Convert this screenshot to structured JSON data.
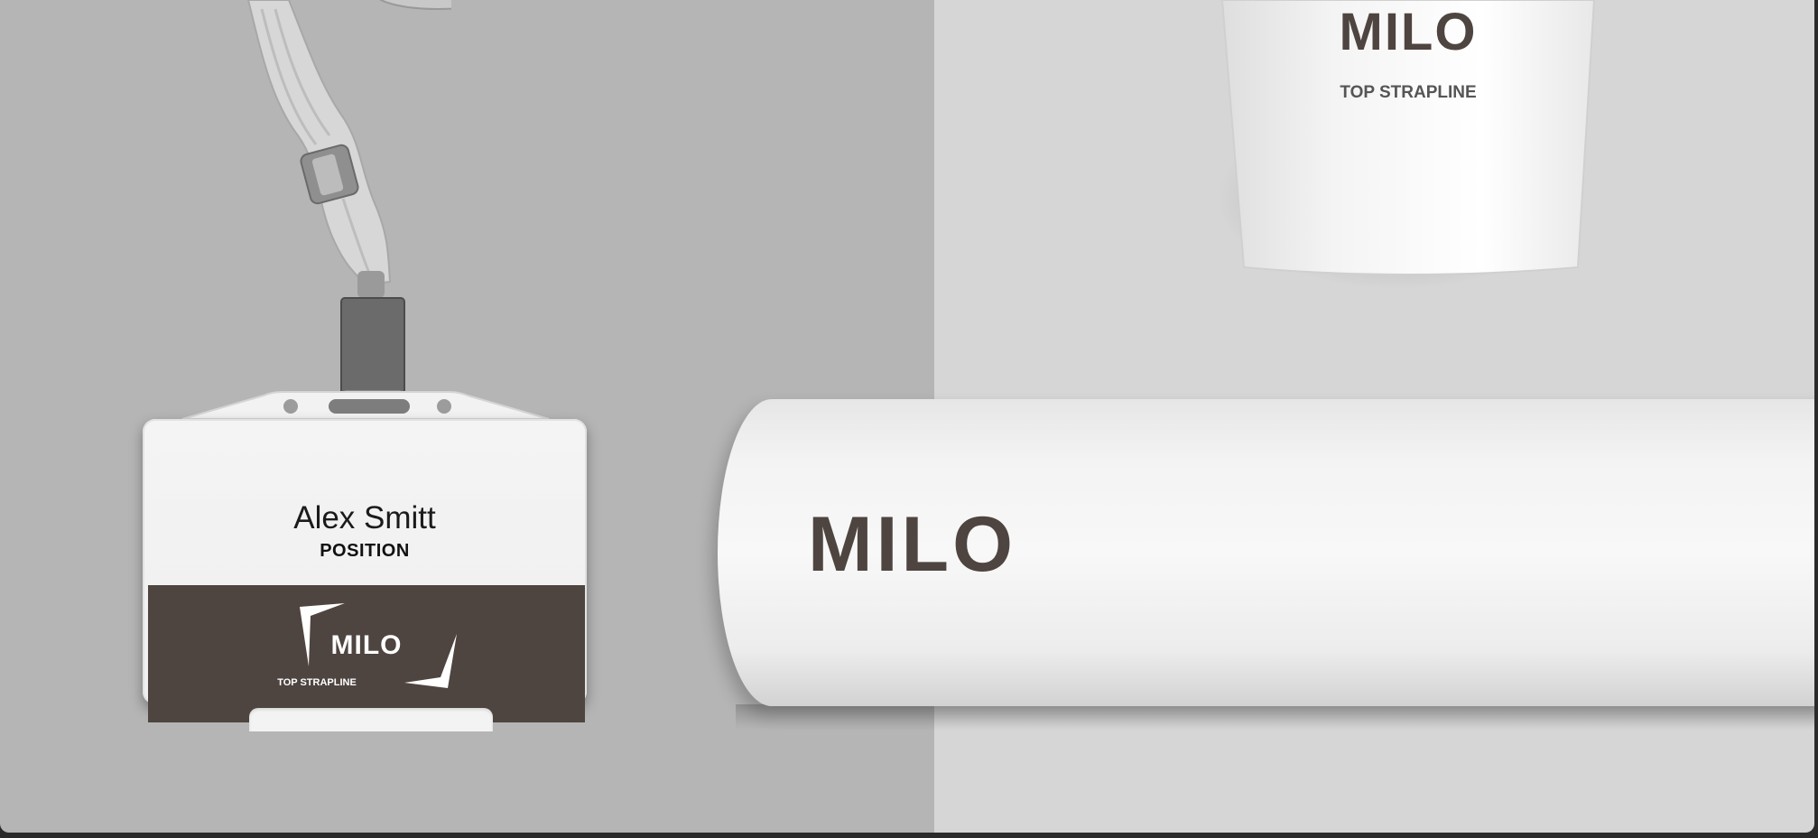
{
  "badge": {
    "name": "Alex Smitt",
    "position": "POSITION",
    "logo": "MILO",
    "strapline": "TOP STRAPLINE"
  },
  "cup": {
    "logo": "MILO",
    "strapline": "TOP STRAPLINE"
  },
  "roll": {
    "logo": "MILO"
  },
  "colors": {
    "brand": "#4e4440",
    "background_left": "#b5b5b5",
    "background_right": "#d6d6d6"
  }
}
